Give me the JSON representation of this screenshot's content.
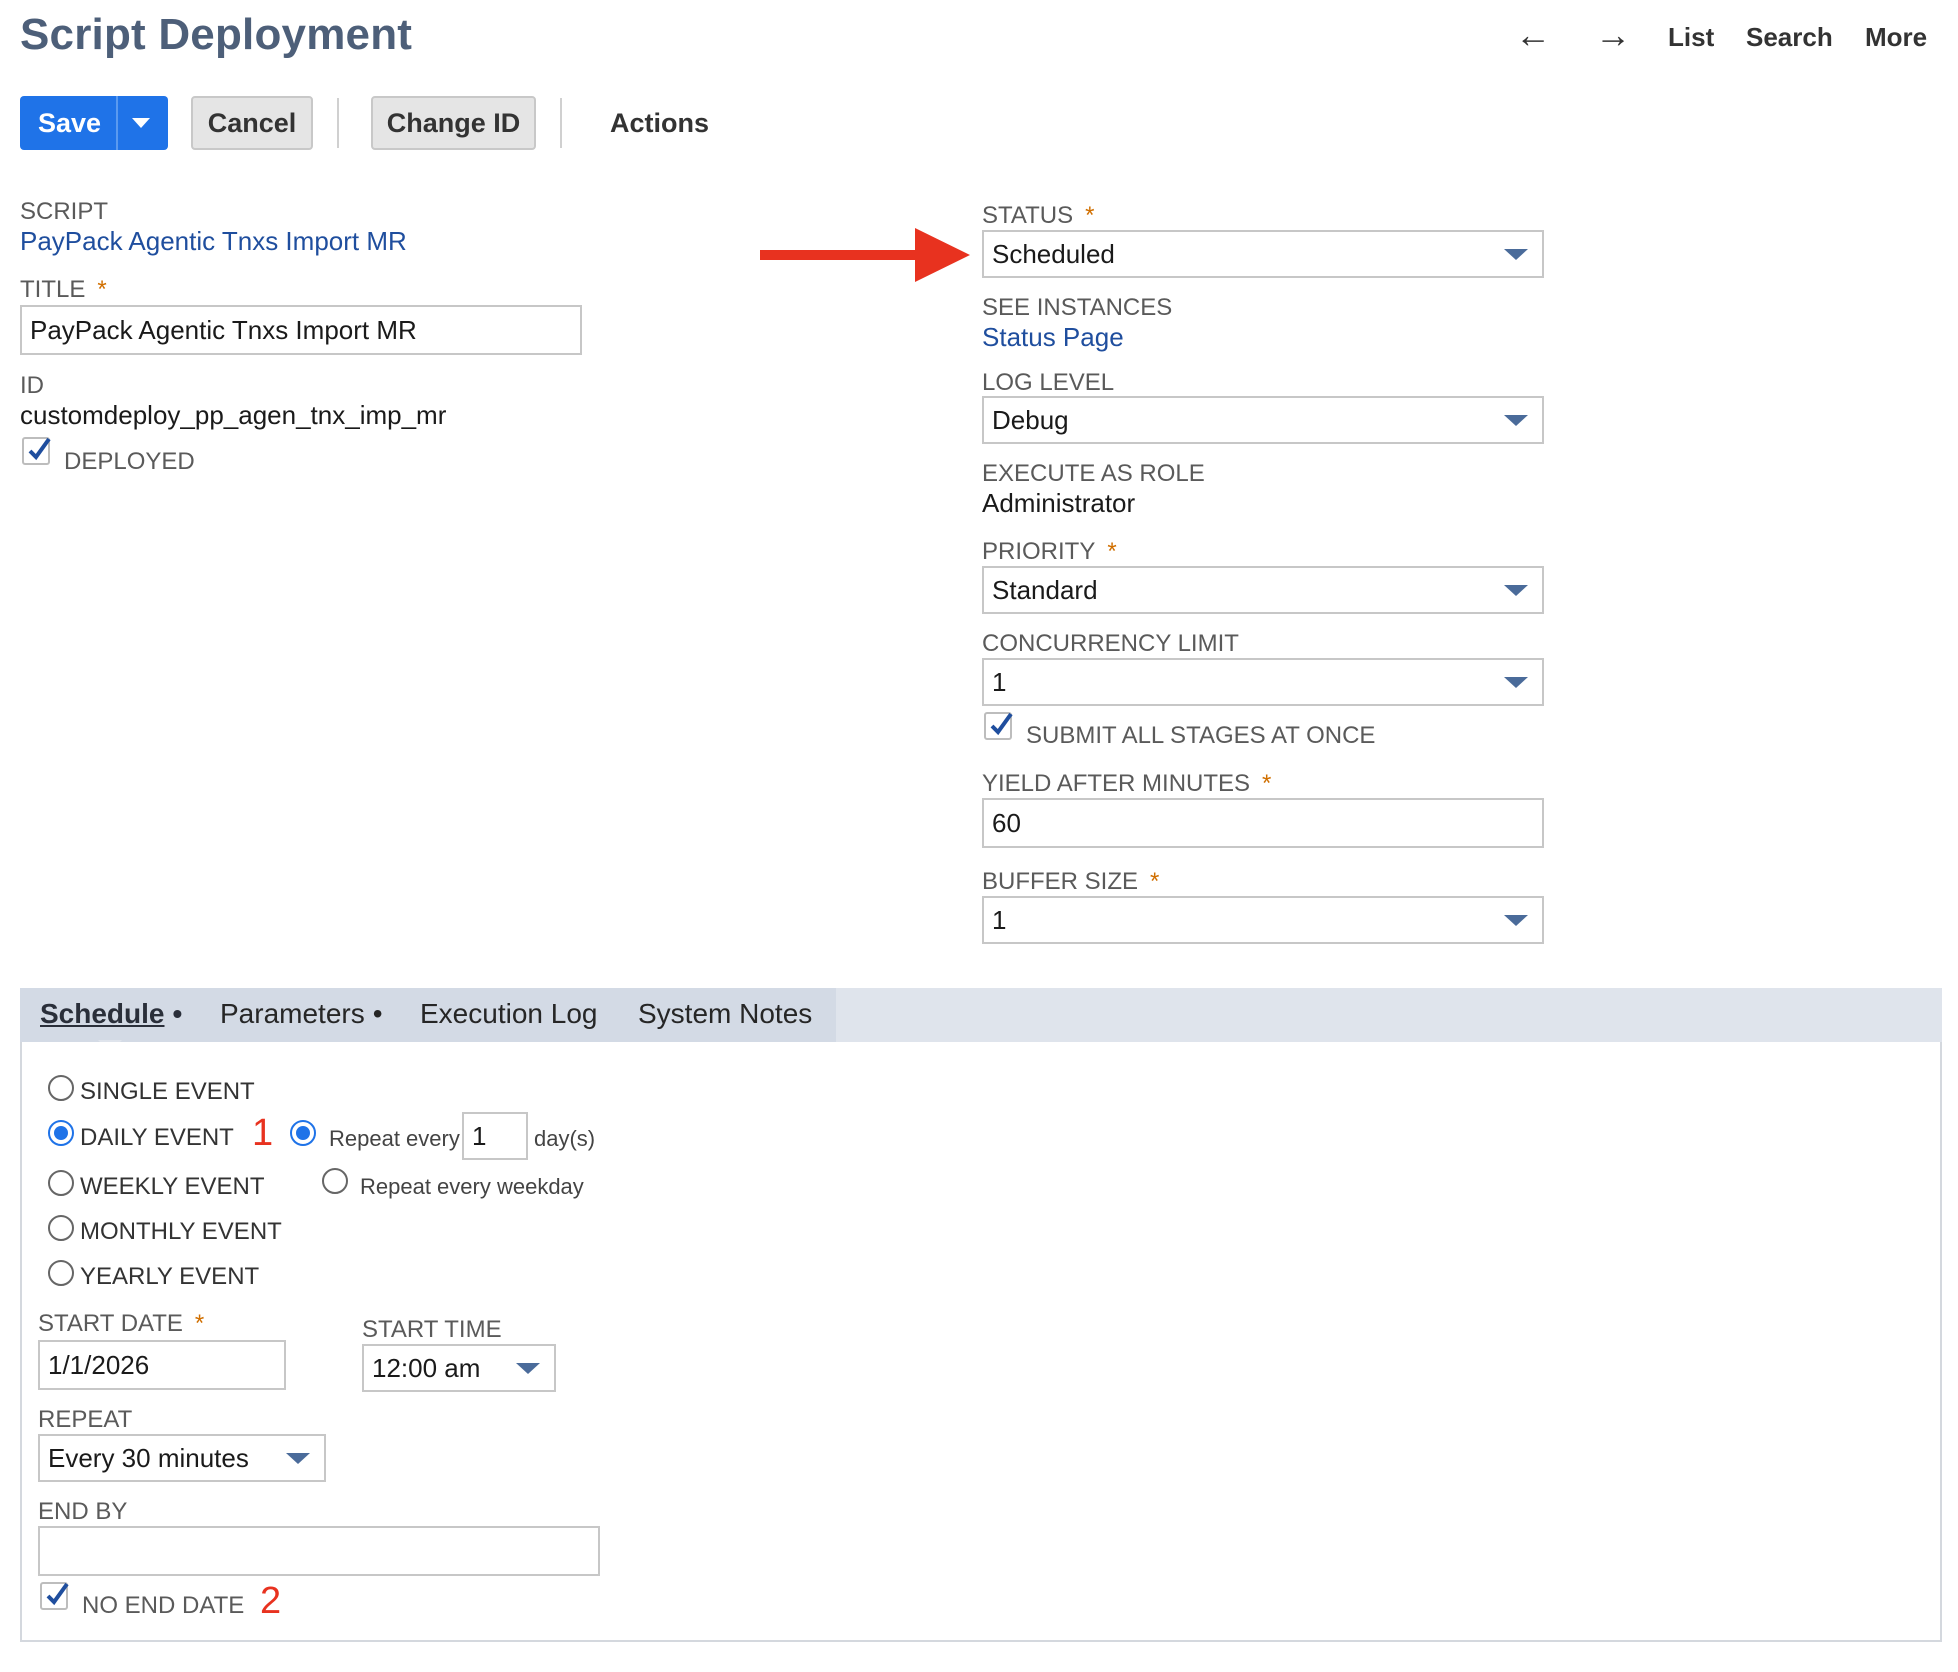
{
  "header": {
    "title": "Script Deployment",
    "nav": {
      "back_icon": "←",
      "forward_icon": "→",
      "list": "List",
      "search": "Search",
      "more": "More"
    }
  },
  "toolbar": {
    "save": "Save",
    "cancel": "Cancel",
    "change_id": "Change ID",
    "actions": "Actions"
  },
  "left": {
    "script_label": "SCRIPT",
    "script_value": "PayPack Agentic Tnxs Import MR",
    "title_label": "TITLE",
    "title_value": "PayPack Agentic Tnxs Import MR",
    "id_label": "ID",
    "id_value": "customdeploy_pp_agen_tnx_imp_mr",
    "deployed_label": "DEPLOYED",
    "deployed_checked": true
  },
  "right": {
    "status_label": "STATUS",
    "status_value": "Scheduled",
    "see_instances_label": "SEE INSTANCES",
    "see_instances_link": "Status Page",
    "log_level_label": "LOG LEVEL",
    "log_level_value": "Debug",
    "execute_as_role_label": "EXECUTE AS ROLE",
    "execute_as_role_value": "Administrator",
    "priority_label": "PRIORITY",
    "priority_value": "Standard",
    "concurrency_label": "CONCURRENCY LIMIT",
    "concurrency_value": "1",
    "submit_all_label": "SUBMIT ALL STAGES AT ONCE",
    "submit_all_checked": true,
    "yield_label": "YIELD AFTER MINUTES",
    "yield_value": "60",
    "buffer_label": "BUFFER SIZE",
    "buffer_value": "1"
  },
  "required_mark": "*",
  "annotation": {
    "arrow_color": "#e8321f",
    "mark_1": "1",
    "mark_2": "2"
  },
  "tabs": [
    {
      "label": "Schedule",
      "dot": "•",
      "active": true
    },
    {
      "label": "Parameters",
      "dot": "•",
      "active": false
    },
    {
      "label": "Execution Log",
      "dot": "",
      "active": false
    },
    {
      "label": "System Notes",
      "dot": "",
      "active": false
    }
  ],
  "schedule": {
    "events": [
      "SINGLE EVENT",
      "DAILY EVENT",
      "WEEKLY EVENT",
      "MONTHLY EVENT",
      "YEARLY EVENT"
    ],
    "selected_event": "DAILY EVENT",
    "repeat_every_label": "Repeat every",
    "repeat_every_value": "1",
    "days_unit": "day(s)",
    "repeat_weekday_label": "Repeat every weekday",
    "start_date_label": "START DATE",
    "start_date_value": "1/1/2026",
    "start_time_label": "START TIME",
    "start_time_value": "12:00 am",
    "repeat_label": "REPEAT",
    "repeat_value": "Every 30 minutes",
    "end_by_label": "END BY",
    "end_by_value": "",
    "no_end_date_label": "NO END DATE",
    "no_end_date_checked": true
  },
  "colors": {
    "primary_button": "#1f73e8",
    "link": "#1f4e9e",
    "required": "#d06f00",
    "title": "#4d5f79"
  }
}
